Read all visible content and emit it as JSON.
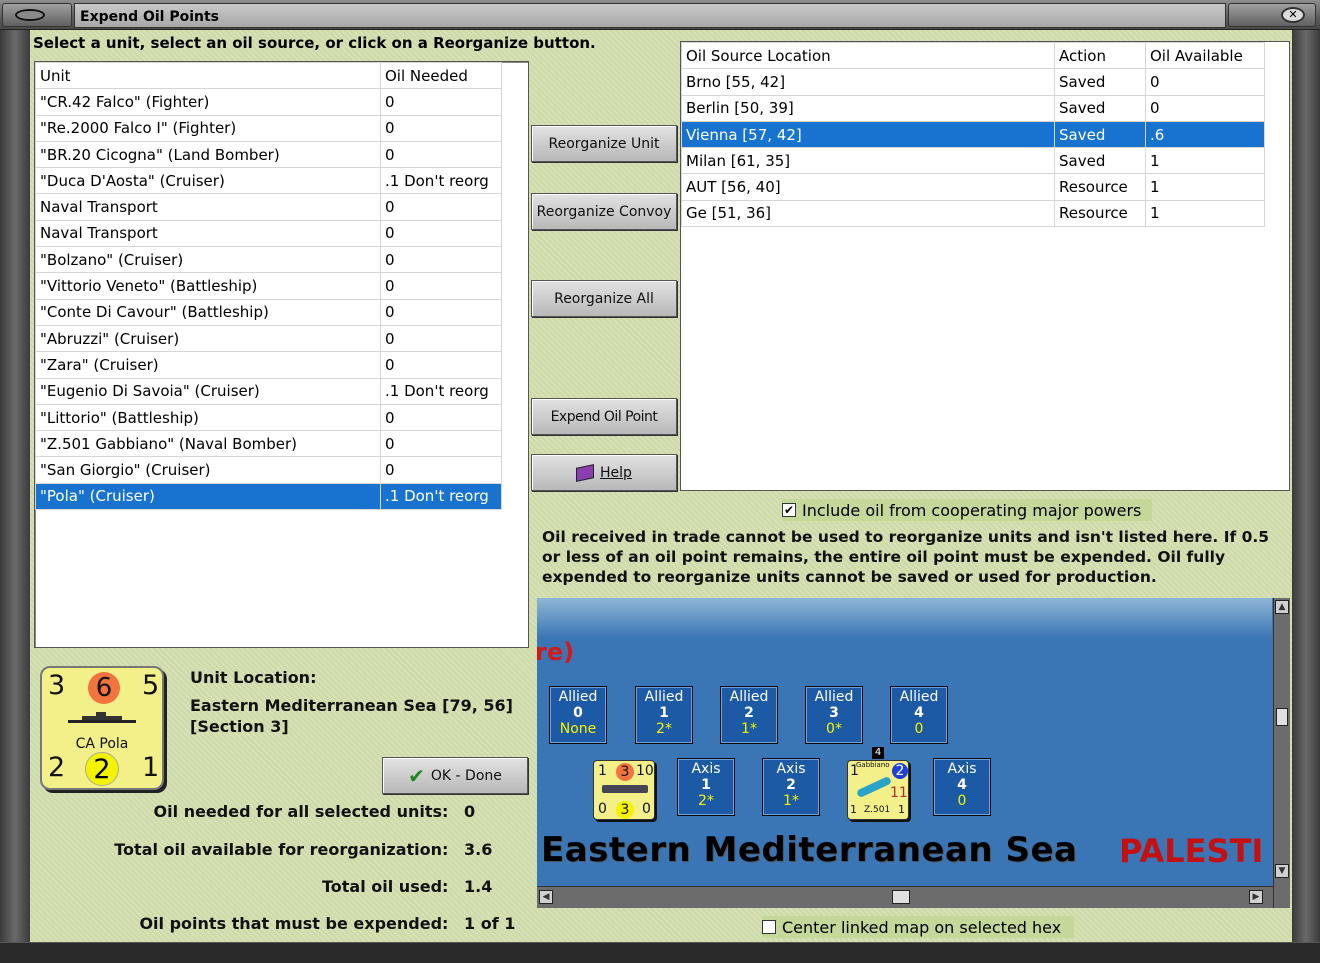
{
  "window": {
    "title": "Expend Oil Points"
  },
  "instructions": "Select a unit, select an oil source, or click on a Reorganize button.",
  "units_table": {
    "headers": [
      "Unit",
      "Oil Needed"
    ],
    "rows": [
      [
        "\"CR.42 Falco\" (Fighter)",
        "0"
      ],
      [
        "\"Re.2000 Falco I\" (Fighter)",
        "0"
      ],
      [
        "\"BR.20 Cicogna\" (Land Bomber)",
        "0"
      ],
      [
        "\"Duca D'Aosta\" (Cruiser)",
        ".1 Don't reorg"
      ],
      [
        "Naval Transport",
        "0"
      ],
      [
        "Naval Transport",
        "0"
      ],
      [
        "\"Bolzano\" (Cruiser)",
        "0"
      ],
      [
        "\"Vittorio Veneto\" (Battleship)",
        "0"
      ],
      [
        "\"Conte Di Cavour\" (Battleship)",
        "0"
      ],
      [
        "\"Abruzzi\" (Cruiser)",
        "0"
      ],
      [
        "\"Zara\" (Cruiser)",
        "0"
      ],
      [
        "\"Eugenio Di Savoia\" (Cruiser)",
        ".1 Don't reorg"
      ],
      [
        "\"Littorio\" (Battleship)",
        "0"
      ],
      [
        "\"Z.501 Gabbiano\" (Naval Bomber)",
        "0"
      ],
      [
        "\"San Giorgio\" (Cruiser)",
        "0"
      ],
      [
        "\"Pola\" (Cruiser)",
        ".1 Don't reorg"
      ]
    ],
    "selected_index": 15
  },
  "oil_table": {
    "headers": [
      "Oil Source Location",
      "Action",
      "Oil Available"
    ],
    "rows": [
      [
        "Brno [55, 42]",
        "Saved",
        "0"
      ],
      [
        "Berlin [50, 39]",
        "Saved",
        "0"
      ],
      [
        "Vienna [57, 42]",
        "Saved",
        ".6"
      ],
      [
        "Milan [61, 35]",
        "Saved",
        "1"
      ],
      [
        "AUT [56, 40]",
        "Resource",
        "1"
      ],
      [
        "Ge [51, 36]",
        "Resource",
        "1"
      ]
    ],
    "selected_index": 2
  },
  "buttons": {
    "reorganize_unit": "Reorganize Unit",
    "reorganize_convoy": "Reorganize Convoy",
    "reorganize_all": "Reorganize All",
    "expend_oil_point": "Expend Oil Point",
    "help": "Help",
    "ok_done": "OK - Done"
  },
  "include_oil": {
    "label": "Include oil from cooperating major powers",
    "checked": true
  },
  "note": "Oil received in trade cannot be used to reorganize units and isn't listed here.  If 0.5 or less of an oil point remains, the entire oil point must be expended.   Oil fully expended to reorganize units cannot be saved or used for production.",
  "counter": {
    "top_left": "3",
    "top_mid": "6",
    "top_right": "5",
    "name": "CA Pola",
    "bot_left": "2",
    "bot_mid": "2",
    "bot_right": "1"
  },
  "unit_location": {
    "label": "Unit Location:",
    "line1": "Eastern Mediterranean Sea [79, 56]",
    "line2": "[Section 3]"
  },
  "summary": {
    "needed_label": "Oil needed for all selected units:",
    "needed_value": "0",
    "available_label": "Total oil available for reorganization:",
    "available_value": "3.6",
    "used_label": "Total oil used:",
    "used_value": "1.4",
    "expend_label": "Oil points that must be expended:",
    "expend_value": "1 of 1"
  },
  "map": {
    "red_fragment": "re)",
    "sea_name": "Eastern Mediterranean Sea",
    "country_fragment": "PALESTI",
    "allied_boxes": [
      {
        "label": "Allied",
        "num": "0",
        "sub": "None"
      },
      {
        "label": "Allied",
        "num": "1",
        "sub": "2*"
      },
      {
        "label": "Allied",
        "num": "2",
        "sub": "1*"
      },
      {
        "label": "Allied",
        "num": "3",
        "sub": "0*"
      },
      {
        "label": "Allied",
        "num": "4",
        "sub": "0"
      }
    ],
    "axis_boxes": [
      {
        "label": "Axis",
        "num": "1",
        "sub": "2*"
      },
      {
        "label": "Axis",
        "num": "2",
        "sub": "1*"
      },
      {
        "label": "Axis",
        "num": "4",
        "sub": "0"
      }
    ],
    "ship_counter": {
      "a": "1",
      "b": "3",
      "c": "10",
      "d": "0",
      "e": "3",
      "f": "0"
    },
    "plane_counter": {
      "a": "1",
      "b": "2",
      "c": "11",
      "d": "1",
      "e": "Z.501",
      "f": "1",
      "badge": "4",
      "name": "Gabbiano"
    }
  },
  "center_map": {
    "label": "Center linked map on selected hex",
    "checked": false
  }
}
